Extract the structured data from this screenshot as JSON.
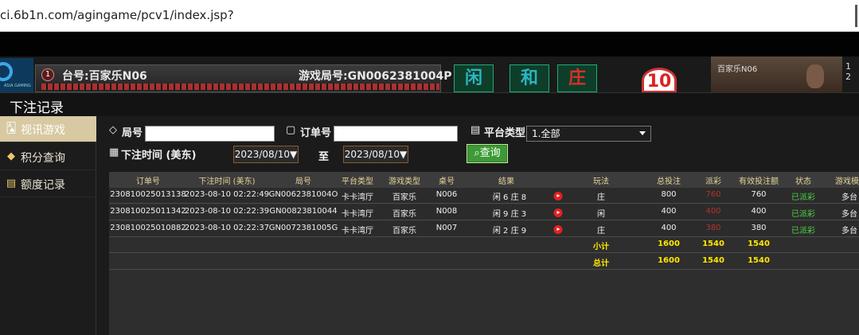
{
  "browser": {
    "url": "ci.6b1n.com/agingame/pcv1/index.jsp?"
  },
  "game": {
    "table_badge": "1",
    "table_name": "台号:百家乐N06",
    "round_id": "游戏局号:GN0062381004P",
    "bet_player": "闲",
    "bet_tie": "和",
    "bet_banker": "庄",
    "timer": "10",
    "preview_label": "百家乐N06",
    "page_num": "1 2"
  },
  "modal": {
    "title": "下注记录"
  },
  "sidebar": {
    "items": [
      {
        "label": "视讯游戏",
        "icon": "cards-icon",
        "active": true
      },
      {
        "label": "积分查询",
        "icon": "diamond-icon",
        "active": false
      },
      {
        "label": "额度记录",
        "icon": "document-icon",
        "active": false
      }
    ]
  },
  "filters": {
    "round_label": "局号",
    "round_value": "",
    "order_label": "订单号",
    "order_value": "",
    "platform_label": "平台类型",
    "platform_value": "1.全部",
    "time_label": "下注时间 (美东)",
    "date_from": "2023/08/10▼",
    "to_label": "至",
    "date_to": "2023/08/10▼",
    "query_button": "查询"
  },
  "table": {
    "headers": [
      "订单号",
      "下注时间 (美东)",
      "局号",
      "平台类型",
      "游戏类型",
      "桌号",
      "结果",
      "玩法",
      "总投注",
      "派彩",
      "有效投注额",
      "状态",
      "游戏模"
    ],
    "rows": [
      {
        "order": "230810025013138",
        "time": "2023-08-10 02:22:49",
        "round": "GN0062381004O",
        "platform": "卡卡湾厅",
        "game": "百家乐",
        "table": "N006",
        "result": "闲 6 庄 8",
        "play": "庄",
        "total": "800",
        "payout": "760",
        "valid": "760",
        "status": "已派彩",
        "mode": "多台"
      },
      {
        "order": "230810025011342",
        "time": "2023-08-10 02:22:39",
        "round": "GN00823810044",
        "platform": "卡卡湾厅",
        "game": "百家乐",
        "table": "N008",
        "result": "闲 9 庄 3",
        "play": "闲",
        "total": "400",
        "payout": "400",
        "valid": "400",
        "status": "已派彩",
        "mode": "多台"
      },
      {
        "order": "230810025010882",
        "time": "2023-08-10 02:22:37",
        "round": "GN0072381005G",
        "platform": "卡卡湾厅",
        "game": "百家乐",
        "table": "N007",
        "result": "闲 2 庄 9",
        "play": "庄",
        "total": "400",
        "payout": "380",
        "valid": "380",
        "status": "已派彩",
        "mode": "多台"
      }
    ],
    "subtotal": {
      "label": "小计",
      "total": "1600",
      "payout": "1540",
      "valid": "1540"
    },
    "grand_total": {
      "label": "总计",
      "total": "1600",
      "payout": "1540",
      "valid": "1540"
    }
  }
}
